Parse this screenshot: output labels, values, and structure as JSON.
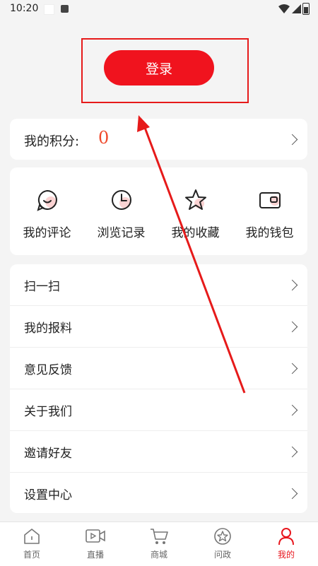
{
  "status_bar": {
    "time": "10:20"
  },
  "login": {
    "label": "登录"
  },
  "points": {
    "label": "我的积分:",
    "value": "0"
  },
  "quick_actions": [
    {
      "label": "我的评论",
      "icon": "comment-icon"
    },
    {
      "label": "浏览记录",
      "icon": "clock-icon"
    },
    {
      "label": "我的收藏",
      "icon": "star-icon"
    },
    {
      "label": "我的钱包",
      "icon": "wallet-icon"
    }
  ],
  "menu": [
    {
      "label": "扫一扫"
    },
    {
      "label": "我的报料"
    },
    {
      "label": "意见反馈"
    },
    {
      "label": "关于我们"
    },
    {
      "label": "邀请好友"
    },
    {
      "label": "设置中心"
    }
  ],
  "tabs": [
    {
      "label": "首页",
      "icon": "home-icon"
    },
    {
      "label": "直播",
      "icon": "video-icon"
    },
    {
      "label": "商城",
      "icon": "cart-icon"
    },
    {
      "label": "问政",
      "icon": "star-circle-icon"
    },
    {
      "label": "我的",
      "icon": "person-icon",
      "active": true
    }
  ],
  "colors": {
    "accent": "#f0131e",
    "points_value": "#ef4a2c",
    "annotation": "#e61a1a",
    "background": "#f4f4f4"
  }
}
